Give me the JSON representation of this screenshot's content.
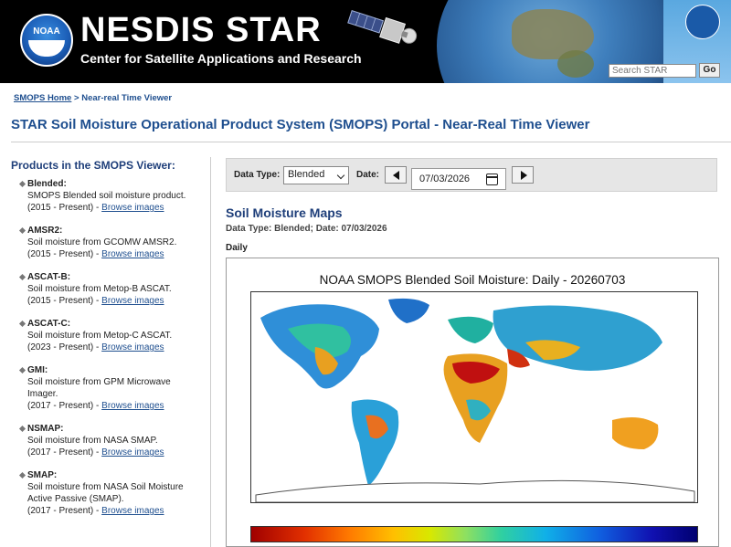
{
  "header": {
    "logo_text": "NOAA",
    "brand": "NESDIS STAR",
    "subtitle": "Center for Satellite Applications and Research",
    "search_placeholder": "Search STAR",
    "search_button": "Go"
  },
  "breadcrumb": {
    "home": "SMOPS Home",
    "separator": ">",
    "current": "Near-real Time Viewer"
  },
  "page_title": "STAR Soil Moisture Operational Product System (SMOPS) Portal - Near-Real Time Viewer",
  "sidebar": {
    "heading": "Products in the SMOPS Viewer:",
    "products": [
      {
        "name": "Blended:",
        "desc": "SMOPS Blended soil moisture product.",
        "years": "(2015 - Present) - ",
        "link": "Browse images"
      },
      {
        "name": "AMSR2:",
        "desc": "Soil moisture from GCOMW AMSR2.",
        "years": "(2015 - Present) - ",
        "link": "Browse images"
      },
      {
        "name": "ASCAT-B:",
        "desc": "Soil moisture from Metop-B ASCAT.",
        "years": "(2015 - Present) - ",
        "link": "Browse images"
      },
      {
        "name": "ASCAT-C:",
        "desc": "Soil moisture from Metop-C ASCAT.",
        "years": "(2023 - Present) - ",
        "link": "Browse images"
      },
      {
        "name": "GMI:",
        "desc": "Soil moisture from GPM Microwave Imager.",
        "years": "(2017 - Present) - ",
        "link": "Browse images"
      },
      {
        "name": "NSMAP:",
        "desc": "Soil moisture from NASA SMAP.",
        "years": "(2017 - Present) - ",
        "link": "Browse images"
      },
      {
        "name": "SMAP:",
        "desc": "Soil moisture from NASA Soil Moisture Active Passive (SMAP).",
        "years": "(2017 - Present) - ",
        "link": "Browse images"
      }
    ]
  },
  "controls": {
    "data_type_label": "Data Type:",
    "data_type_value": "Blended",
    "date_label": "Date:",
    "date_value": "07/03/2026"
  },
  "content": {
    "maps_title": "Soil Moisture Maps",
    "maps_subtitle": "Data Type: Blended; Date: 07/03/2026",
    "daily_label": "Daily",
    "figure_title": "NOAA SMOPS Blended Soil Moisture: Daily - 20260703"
  },
  "colors": {
    "link": "#1f4f8f",
    "heading": "#1f3f7a",
    "banner": "#000000"
  },
  "icons": [
    "noaa-logo",
    "satellite-icon",
    "seal-icon",
    "calendar-icon",
    "arrow-left-icon",
    "arrow-right-icon",
    "chevron-down-icon"
  ]
}
